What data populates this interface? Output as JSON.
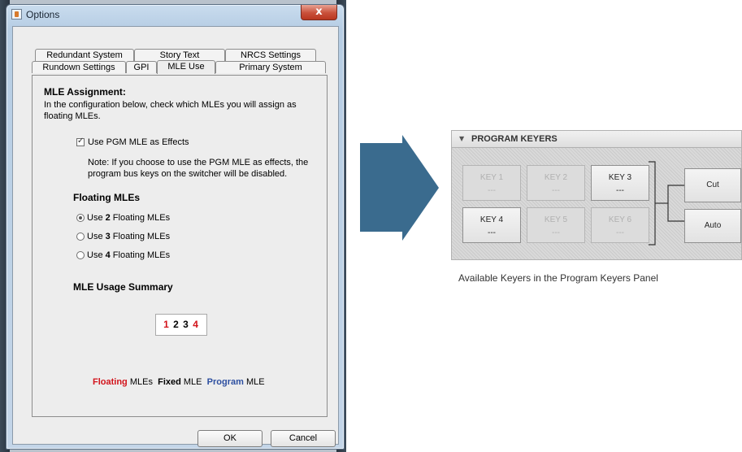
{
  "window": {
    "title": "Options",
    "close_label": "x"
  },
  "tabs": {
    "row1": [
      "Redundant System",
      "Story Text",
      "NRCS Settings"
    ],
    "row2": [
      "Rundown Settings",
      "GPI",
      "MLE Use",
      "Primary System"
    ],
    "active": "MLE Use"
  },
  "assignment": {
    "heading": "MLE Assignment:",
    "desc_line1": "In the configuration below, check which MLEs you will assign as",
    "desc_line2": "floating MLEs.",
    "checkbox_label": "Use PGM MLE as Effects",
    "checked": true,
    "note_line1": "Note: If you choose to use the PGM MLE as effects, the",
    "note_line2": "program bus keys on the switcher will be disabled."
  },
  "floating": {
    "heading": "Floating MLEs",
    "options": [
      {
        "pre": "Use ",
        "num": "2",
        "post": " Floating MLEs",
        "selected": true
      },
      {
        "pre": "Use ",
        "num": "3",
        "post": " Floating MLEs",
        "selected": false
      },
      {
        "pre": "Use ",
        "num": "4",
        "post": " Floating MLEs",
        "selected": false
      }
    ]
  },
  "summary": {
    "heading": "MLE Usage Summary",
    "digits": [
      "1",
      "2",
      "3",
      "4"
    ],
    "digit_colors": [
      "#d2131b",
      "#000000",
      "#000000",
      "#d2131b"
    ]
  },
  "legend": {
    "floating": "Floating",
    "floating_suffix": "MLEs",
    "fixed": "Fixed",
    "fixed_suffix": "MLE",
    "program": "Program",
    "program_suffix": "MLE",
    "floating_color": "#d2131b",
    "program_color": "#2d4fa0"
  },
  "buttons": {
    "ok": "OK",
    "cancel": "Cancel"
  },
  "arrow_color": "#3a6b8e",
  "keyers": {
    "header": "PROGRAM KEYERS",
    "keys": [
      {
        "label": "KEY 1",
        "value": "---",
        "enabled": false
      },
      {
        "label": "KEY 2",
        "value": "---",
        "enabled": false
      },
      {
        "label": "KEY 3",
        "value": "---",
        "enabled": true
      },
      {
        "label": "KEY 4",
        "value": "---",
        "enabled": true
      },
      {
        "label": "KEY 5",
        "value": "---",
        "enabled": false
      },
      {
        "label": "KEY 6",
        "value": "---",
        "enabled": false
      }
    ],
    "cut": "Cut",
    "auto": "Auto",
    "caption": "Available Keyers in the Program Keyers Panel"
  }
}
